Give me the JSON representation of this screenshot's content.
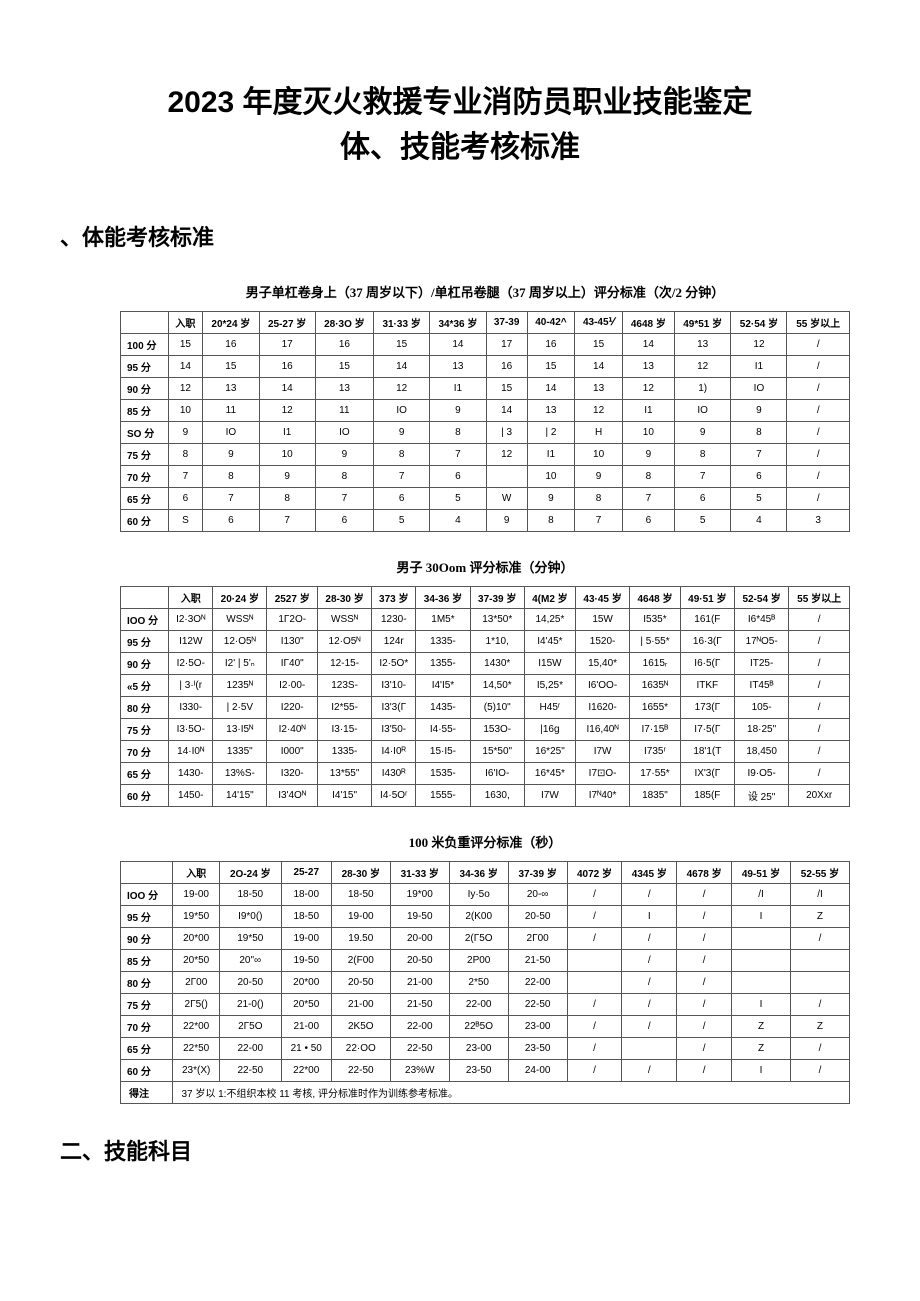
{
  "title_line1": "2023 年度灭火救援专业消防员职业技能鉴定",
  "title_line2": "体、技能考核标准",
  "section1_header": "、体能考核标准",
  "section2_header": "二、技能科目",
  "table1": {
    "caption": "男子单杠卷身上（37 周岁以下）/单杠吊卷腿（37 周岁以上）评分标准（次/2 分钟）",
    "headers": [
      "",
      "入职",
      "20*24 岁",
      "25-27 岁",
      "28·3O 岁",
      "31·33 岁",
      "34*36 岁",
      "37-39",
      "40-42^",
      "43-45⅟",
      "4648 岁",
      "49*51 岁",
      "52·54 岁",
      "55 岁以上"
    ],
    "rows": [
      {
        "label": "100 分",
        "cells": [
          "15",
          "16",
          "17",
          "16",
          "15",
          "14",
          "17",
          "16",
          "15",
          "14",
          "13",
          "12",
          "/"
        ]
      },
      {
        "label": "95 分",
        "cells": [
          "14",
          "15",
          "16",
          "15",
          "14",
          "13",
          "16",
          "15",
          "14",
          "13",
          "12",
          "I1",
          "/"
        ]
      },
      {
        "label": "90 分",
        "cells": [
          "12",
          "13",
          "14",
          "13",
          "12",
          "I1",
          "15",
          "14",
          "13",
          "12",
          "1)",
          "IO",
          "/"
        ]
      },
      {
        "label": "85 分",
        "cells": [
          "10",
          "11",
          "12",
          "11",
          "IO",
          "9",
          "14",
          "13",
          "12",
          "I1",
          "IO",
          "9",
          "/"
        ]
      },
      {
        "label": "SO 分",
        "cells": [
          "9",
          "IO",
          "I1",
          "IO",
          "9",
          "8",
          "| 3",
          "| 2",
          "H",
          "10",
          "9",
          "8",
          "/"
        ]
      },
      {
        "label": "75 分",
        "cells": [
          "8",
          "9",
          "10",
          "9",
          "8",
          "7",
          "12",
          "I1",
          "10",
          "9",
          "8",
          "7",
          "/"
        ]
      },
      {
        "label": "70 分",
        "cells": [
          "7",
          "8",
          "9",
          "8",
          "7",
          "6",
          "",
          "10",
          "9",
          "8",
          "7",
          "6",
          "/"
        ]
      },
      {
        "label": "65 分",
        "cells": [
          "6",
          "7",
          "8",
          "7",
          "6",
          "5",
          "W",
          "9",
          "8",
          "7",
          "6",
          "5",
          "/"
        ]
      },
      {
        "label": "60 分",
        "cells": [
          "S",
          "6",
          "7",
          "6",
          "5",
          "4",
          "9",
          "8",
          "7",
          "6",
          "5",
          "4",
          "3"
        ]
      }
    ]
  },
  "table2": {
    "caption": "男子 30Oom 评分标准（分钟）",
    "headers": [
      "",
      "入职",
      "20·24 岁",
      "2527 岁",
      "28-30 岁",
      "373 岁",
      "34-36 岁",
      "37-39 岁",
      "4(M2 岁",
      "43·45 岁",
      "4648 岁",
      "49·51 岁",
      "52-54 岁",
      "55 岁以上"
    ],
    "rows": [
      {
        "label": "IOO 分",
        "cells": [
          "I2·3Oᴺ",
          "WSSᴺ",
          "1Γ2O-",
          "WSSᴺ",
          "1230-",
          "1M5*",
          "13*50*",
          "14,25*",
          "15W",
          "I535*",
          "161(F",
          "I6*45ᴮ",
          "/"
        ]
      },
      {
        "label": "95 分",
        "cells": [
          "I12W",
          "12·O5ᴺ",
          "I130\"",
          "12·O5ᴺ",
          "124r",
          "1335-",
          "1*10,",
          "I4'45*",
          "1520-",
          "| 5·55*",
          "16·3(Γ",
          "17ᴺO5-",
          "/"
        ]
      },
      {
        "label": "90 分",
        "cells": [
          "I2·5O-",
          "I2' | 5'ₙ",
          "IΓ40\"",
          "12-15-",
          "I2·5O*",
          "1355-",
          "1430*",
          "I15W",
          "15,40*",
          "1615ᵣ",
          "I6·5(Γ",
          "IT25-",
          "/"
        ]
      },
      {
        "label": "«5 分",
        "cells": [
          "| 3·ᴵ(r",
          "1235ᴺ",
          "I2·00-",
          "123S-",
          "I3'10-",
          "I4'I5*",
          "14,50*",
          "I5,25*",
          "I6'OO-",
          "1635ᴺ",
          "ITKF",
          "IT45ᴮ",
          "/"
        ]
      },
      {
        "label": "80 分",
        "cells": [
          "I330-",
          "| 2·5V",
          "I220-",
          "I2*55-",
          "I3'3(Γ",
          "1435-",
          "(5)10\"",
          "H45ʳ",
          "I1620-",
          "1655*",
          "173(Γ",
          "105-",
          "/"
        ]
      },
      {
        "label": "75 分",
        "cells": [
          "I3·5O-",
          "13·I5ᴺ",
          "I2·40ᴺ",
          "I3·15-",
          "I3'50-",
          "I4·55-",
          "153O-",
          "|16g",
          "I16,40ᴺ",
          "I7·15ᴮ",
          "I7·5(Γ",
          "18·25\"",
          "/"
        ]
      },
      {
        "label": "70 分",
        "cells": [
          "14·I0ᴺ",
          "1335\"",
          "I000\"",
          "1335-",
          "I4·I0ᴿ",
          "15·I5-",
          "15*50\"",
          "16*25\"",
          "I7W",
          "I735ʳ",
          "18'1(T",
          "18,450",
          "/"
        ]
      },
      {
        "label": "65 分",
        "cells": [
          "1430-",
          "13%S-",
          "I320-",
          "13*55\"",
          "I430ᴿ",
          "1535-",
          "I6'IO-",
          "16*45*",
          "I7⊡O-",
          "17·55*",
          "IX'3(Γ",
          "I9·O5-",
          "/"
        ]
      },
      {
        "label": "60 分",
        "cells": [
          "1450-",
          "14'15\"",
          "I3'4Oᴺ",
          "I4'15\"",
          "I4·5Oʳ",
          "1555-",
          "1630,",
          "I7W",
          "I7ᴺ40*",
          "1835\"",
          "185(F",
          "设 25\"",
          "20Xxr"
        ]
      }
    ]
  },
  "table3": {
    "caption": "100 米负重评分标准（秒）",
    "headers": [
      "",
      "入职",
      "2O-24 岁",
      "25-27",
      "28-30 岁",
      "31-33 岁",
      "34-36 岁",
      "37-39 岁",
      "4072 岁",
      "4345 岁",
      "4678 岁",
      "49-51 岁",
      "52-55 岁"
    ],
    "rows": [
      {
        "label": "IOO 分",
        "cells": [
          "19-00",
          "18-50",
          "18-00",
          "18-50",
          "19*00",
          "Iy·5o",
          "20-∞",
          "/",
          "/",
          "/",
          "/I",
          "/I"
        ]
      },
      {
        "label": "95 分",
        "cells": [
          "19*50",
          "I9*0()",
          "18-50",
          "19-00",
          "19-50",
          "2(K00",
          "20-50",
          "/",
          "I",
          "/",
          "I",
          "Z"
        ]
      },
      {
        "label": "90 分",
        "cells": [
          "20*00",
          "19*50",
          "19-00",
          "19.50",
          "20-00",
          "2(Γ5O",
          "2Γ00",
          "/",
          "/",
          "/",
          "",
          "/"
        ]
      },
      {
        "label": "85 分",
        "cells": [
          "20*50",
          "20\"∞",
          "19-50",
          "2(F00",
          "20-50",
          "2P00",
          "21-50",
          "",
          "/",
          "/",
          "",
          ""
        ]
      },
      {
        "label": "80 分",
        "cells": [
          "2Γ00",
          "20-50",
          "20*00",
          "20-50",
          "21-00",
          "2*50",
          "22-00",
          "",
          "/",
          "/",
          "",
          ""
        ]
      },
      {
        "label": "75 分",
        "cells": [
          "2Γ5()",
          "21-0()",
          "20*50",
          "21-00",
          "21-50",
          "22-00",
          "22-50",
          "/",
          "/",
          "/",
          "I",
          "/"
        ]
      },
      {
        "label": "70 分",
        "cells": [
          "22*00",
          "2Γ5O",
          "21-00",
          "2K5O",
          "22-00",
          "22ᴮ5O",
          "23-00",
          "/",
          "/",
          "/",
          "Z",
          "Z"
        ]
      },
      {
        "label": "65 分",
        "cells": [
          "22*50",
          "22-00",
          "21 • 50",
          "22·OO",
          "22-50",
          "23-00",
          "23-50",
          "/",
          "",
          "/",
          "Z",
          "/"
        ]
      },
      {
        "label": "60 分",
        "cells": [
          "23*(X)",
          "22-50",
          "22*00",
          "22-50",
          "23%W",
          "23-50",
          "24-00",
          "/",
          "/",
          "/",
          "I",
          "/"
        ]
      }
    ],
    "note": "37 岁以 1:不组织本校 11 考核,    评分标准时作为训练参考标准。",
    "note_label": "得注"
  }
}
